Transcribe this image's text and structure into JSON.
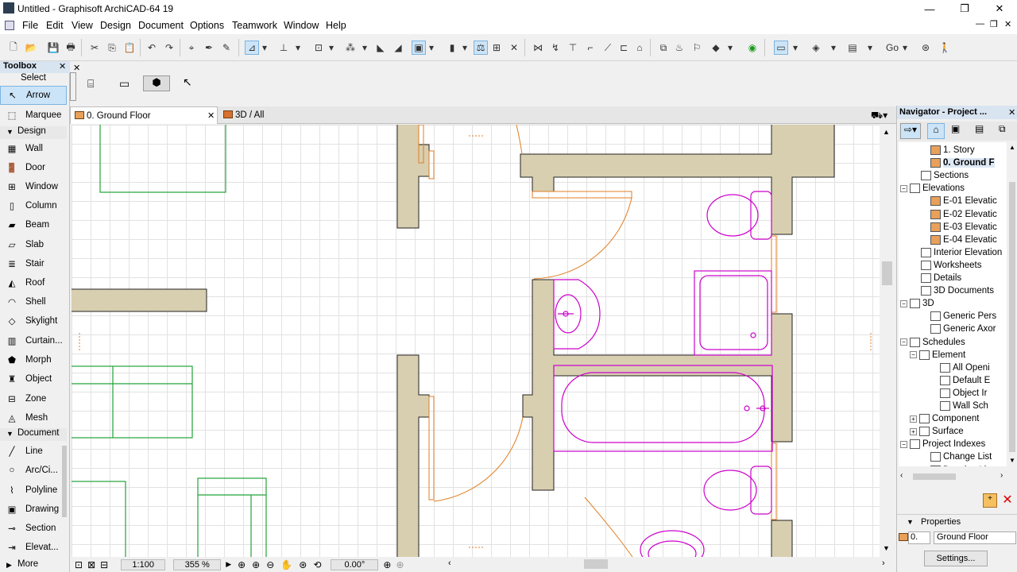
{
  "window": {
    "title": "Untitled - Graphisoft ArchiCAD-64 19",
    "minimize": "—",
    "maximize": "❐",
    "close": "✕"
  },
  "menu": [
    "File",
    "Edit",
    "View",
    "Design",
    "Document",
    "Options",
    "Teamwork",
    "Window",
    "Help"
  ],
  "toolbox": {
    "title": "Toolbox",
    "close": "✕",
    "select_label": "Select",
    "select_tools": [
      {
        "label": "Arrow",
        "icon": "arrow-icon"
      },
      {
        "label": "Marquee",
        "icon": "marquee-icon"
      }
    ],
    "design_label": "Design",
    "design_tools": [
      {
        "label": "Wall",
        "icon": "wall-icon"
      },
      {
        "label": "Door",
        "icon": "door-icon"
      },
      {
        "label": "Window",
        "icon": "window-icon"
      },
      {
        "label": "Column",
        "icon": "column-icon"
      },
      {
        "label": "Beam",
        "icon": "beam-icon"
      },
      {
        "label": "Slab",
        "icon": "slab-icon"
      },
      {
        "label": "Stair",
        "icon": "stair-icon"
      },
      {
        "label": "Roof",
        "icon": "roof-icon"
      },
      {
        "label": "Shell",
        "icon": "shell-icon"
      },
      {
        "label": "Skylight",
        "icon": "skylight-icon"
      },
      {
        "label": "Curtain...",
        "icon": "curtain-wall-icon"
      },
      {
        "label": "Morph",
        "icon": "morph-icon"
      },
      {
        "label": "Object",
        "icon": "object-icon"
      },
      {
        "label": "Zone",
        "icon": "zone-icon"
      },
      {
        "label": "Mesh",
        "icon": "mesh-icon"
      }
    ],
    "document_label": "Document",
    "document_tools": [
      {
        "label": "Line",
        "icon": "line-icon"
      },
      {
        "label": "Arc/Ci...",
        "icon": "arc-icon"
      },
      {
        "label": "Polyline",
        "icon": "polyline-icon"
      },
      {
        "label": "Drawing",
        "icon": "drawing-icon"
      },
      {
        "label": "Section",
        "icon": "section-icon"
      },
      {
        "label": "Elevat...",
        "icon": "elevation-icon"
      }
    ],
    "more_label": "More"
  },
  "tabs": [
    {
      "label": "0. Ground Floor",
      "active": true,
      "close": "✕"
    },
    {
      "label": "3D / All",
      "active": false
    }
  ],
  "statusbar": {
    "scale": "1:100",
    "zoom": "355 %",
    "angle": "0.00°"
  },
  "navigator": {
    "title": "Navigator - Project ...",
    "close": "✕",
    "tree": [
      {
        "label": "1. Story",
        "indent": 3,
        "icon": "story-icon"
      },
      {
        "label": "0. Ground F",
        "indent": 3,
        "icon": "story-icon",
        "selected": true
      },
      {
        "label": "Sections",
        "indent": 2,
        "icon": "sections-icon"
      },
      {
        "label": "Elevations",
        "indent": 1,
        "icon": "elevations-icon",
        "toggle": "−"
      },
      {
        "label": "E-01 Elevatic",
        "indent": 3,
        "icon": "elevation-house-icon"
      },
      {
        "label": "E-02 Elevatic",
        "indent": 3,
        "icon": "elevation-house-icon"
      },
      {
        "label": "E-03 Elevatic",
        "indent": 3,
        "icon": "elevation-house-icon"
      },
      {
        "label": "E-04 Elevatic",
        "indent": 3,
        "icon": "elevation-house-icon"
      },
      {
        "label": "Interior Elevation",
        "indent": 2,
        "icon": "interior-elevation-icon"
      },
      {
        "label": "Worksheets",
        "indent": 2,
        "icon": "worksheets-icon"
      },
      {
        "label": "Details",
        "indent": 2,
        "icon": "details-icon"
      },
      {
        "label": "3D Documents",
        "indent": 2,
        "icon": "3d-documents-icon"
      },
      {
        "label": "3D",
        "indent": 1,
        "icon": "3d-icon",
        "toggle": "−"
      },
      {
        "label": "Generic Pers",
        "indent": 3,
        "icon": "perspective-icon"
      },
      {
        "label": "Generic Axor",
        "indent": 3,
        "icon": "axonometry-icon"
      },
      {
        "label": "Schedules",
        "indent": 1,
        "icon": "schedules-icon",
        "toggle": "−"
      },
      {
        "label": "Element",
        "indent": 2,
        "icon": "element-icon",
        "toggle": "−"
      },
      {
        "label": "All Openi",
        "indent": 4,
        "icon": "schedule-item-icon"
      },
      {
        "label": "Default E",
        "indent": 4,
        "icon": "schedule-item-icon"
      },
      {
        "label": "Object Ir",
        "indent": 4,
        "icon": "schedule-item-icon"
      },
      {
        "label": "Wall Sch",
        "indent": 4,
        "icon": "schedule-item-icon"
      },
      {
        "label": "Component",
        "indent": 2,
        "icon": "component-icon",
        "toggle": "+"
      },
      {
        "label": "Surface",
        "indent": 2,
        "icon": "surface-icon",
        "toggle": "+"
      },
      {
        "label": "Project Indexes",
        "indent": 1,
        "icon": "project-indexes-icon",
        "toggle": "−"
      },
      {
        "label": "Change List",
        "indent": 3,
        "icon": "change-list-icon"
      },
      {
        "label": "Drawing List",
        "indent": 3,
        "icon": "drawing-list-icon"
      }
    ],
    "properties_label": "Properties",
    "properties_id": "0.",
    "properties_value": "Ground Floor",
    "settings_label": "Settings..."
  },
  "colors": {
    "wall_fill": "#d8cfb0",
    "fixture": "#cc00cc",
    "door": "#e07d20",
    "furniture": "#22a33a",
    "grid": "#e2e2e2"
  },
  "toolbar": {
    "go_label": "Go"
  }
}
